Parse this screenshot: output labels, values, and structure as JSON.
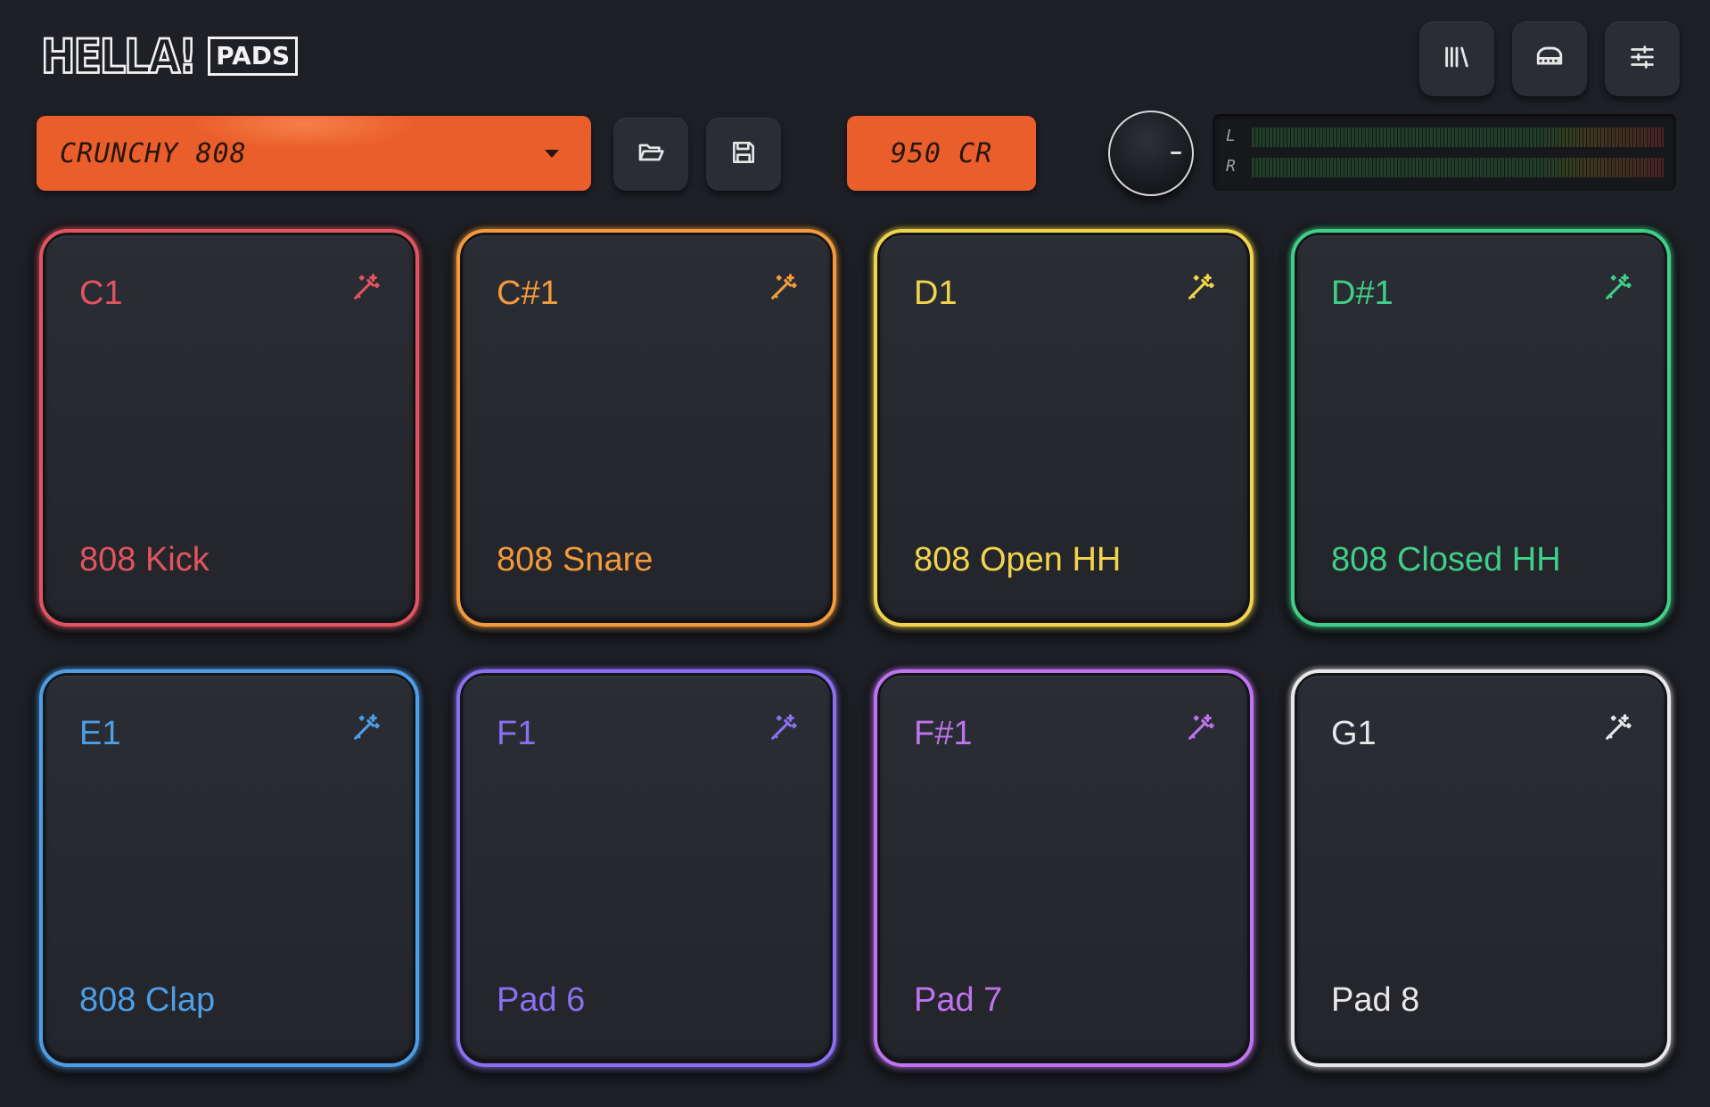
{
  "logo": {
    "main": "HELLA!",
    "sub": "PADS"
  },
  "toolbar": {
    "library_icon": "library-icon",
    "piano_icon": "piano-keys-icon",
    "settings_icon": "sliders-icon"
  },
  "preset": {
    "name": "CRUNCHY 808",
    "open_icon": "folder-open-icon",
    "save_icon": "save-icon"
  },
  "credits": {
    "label": "950 CR"
  },
  "meter": {
    "left_label": "L",
    "right_label": "R"
  },
  "pads": [
    {
      "note": "C1",
      "name": "808 Kick",
      "color": "#e2545f"
    },
    {
      "note": "C#1",
      "name": "808 Snare",
      "color": "#f39a3c"
    },
    {
      "note": "D1",
      "name": "808 Open HH",
      "color": "#f2d44c"
    },
    {
      "note": "D#1",
      "name": "808 Closed HH",
      "color": "#3fcf88"
    },
    {
      "note": "E1",
      "name": "808 Clap",
      "color": "#4d9ee6"
    },
    {
      "note": "F1",
      "name": "Pad 6",
      "color": "#8a6ff0"
    },
    {
      "note": "F#1",
      "name": "Pad 7",
      "color": "#c073ee"
    },
    {
      "note": "G1",
      "name": "Pad 8",
      "color": "#e8e8e8"
    }
  ]
}
